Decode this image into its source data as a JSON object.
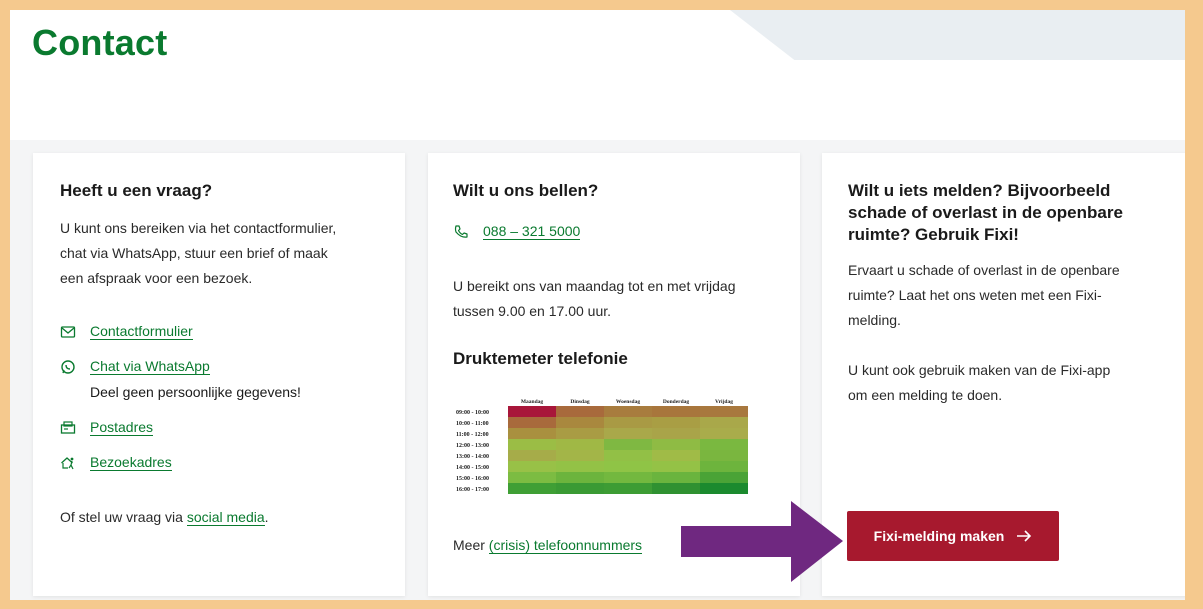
{
  "page": {
    "title": "Contact"
  },
  "card1": {
    "title": "Heeft u een vraag?",
    "intro_lines": [
      "U kunt ons bereiken via het contactformulier,",
      "chat via WhatsApp, stuur een brief of maak",
      "een afspraak voor een bezoek."
    ],
    "links": [
      {
        "label": "Contactformulier",
        "icon": "mail-icon"
      },
      {
        "label": "Chat via WhatsApp",
        "icon": "whatsapp-icon"
      },
      {
        "label": "Postadres",
        "icon": "mailbox-icon"
      },
      {
        "label": "Bezoekadres",
        "icon": "visit-icon"
      }
    ],
    "whatsapp_note": "Deel geen persoonlijke gegevens!",
    "footer_prefix": "Of stel uw vraag via ",
    "footer_link": "social media",
    "footer_suffix": "."
  },
  "card2": {
    "title": "Wilt u ons bellen?",
    "phone": "088 – 321 5000",
    "hours_lines": [
      "U bereikt ons van maandag tot en met vrijdag",
      "tussen 9.00 en 17.00 uur."
    ],
    "meter_title": "Druktemeter telefonie",
    "more_prefix": "Meer ",
    "more_link": "(crisis) telefoonnummers"
  },
  "card3": {
    "title_lines": [
      "Wilt u iets melden? Bijvoorbeeld",
      "schade of overlast in de openbare",
      "ruimte? Gebruik Fixi!"
    ],
    "body1_lines": [
      "Ervaart u schade of overlast in de openbare",
      "ruimte? Laat het ons weten met een Fixi-",
      "melding."
    ],
    "body2_lines": [
      "U kunt ook gebruik maken van de Fixi-app",
      "om een melding te doen."
    ],
    "button_label": "Fixi-melding maken",
    "button_icon": "arrow-right-icon"
  },
  "colors": {
    "green": "#0a7a2f",
    "button": "#a7192e",
    "arrow": "#6f2880",
    "border": "#f5c98e"
  },
  "chart_data": {
    "type": "heatmap",
    "title": "Druktemeter telefonie",
    "columns": [
      "Maandag",
      "Dinsdag",
      "Woensdag",
      "Donderdag",
      "Vrijdag"
    ],
    "rows": [
      "09:00 - 10:00",
      "10:00 - 11:00",
      "11:00 - 12:00",
      "12:00 - 13:00",
      "13:00 - 14:00",
      "14:00 - 15:00",
      "15:00 - 16:00",
      "16:00 - 17:00"
    ],
    "colors": [
      [
        "#a8163a",
        "#a86a3c",
        "#a87c3e",
        "#a8763c",
        "#a8783e"
      ],
      [
        "#a86a3c",
        "#a9883e",
        "#a99a44",
        "#a99e44",
        "#a9a84a"
      ],
      [
        "#a9903f",
        "#a99c44",
        "#a9a84a",
        "#a9a449",
        "#a9ac4b"
      ],
      [
        "#9bbd45",
        "#a0b845",
        "#7fb842",
        "#8fbb44",
        "#7ab840"
      ],
      [
        "#a6ac49",
        "#a3b548",
        "#92c046",
        "#a0bb47",
        "#7ab63f"
      ],
      [
        "#98c147",
        "#93c246",
        "#8fc446",
        "#94c246",
        "#6db43d"
      ],
      [
        "#7cbc42",
        "#6cb43d",
        "#73b83f",
        "#6ab43e",
        "#4aa336"
      ],
      [
        "#3f9f35",
        "#3a9a34",
        "#3d9c34",
        "#2f9131",
        "#1b8a2e"
      ]
    ]
  }
}
